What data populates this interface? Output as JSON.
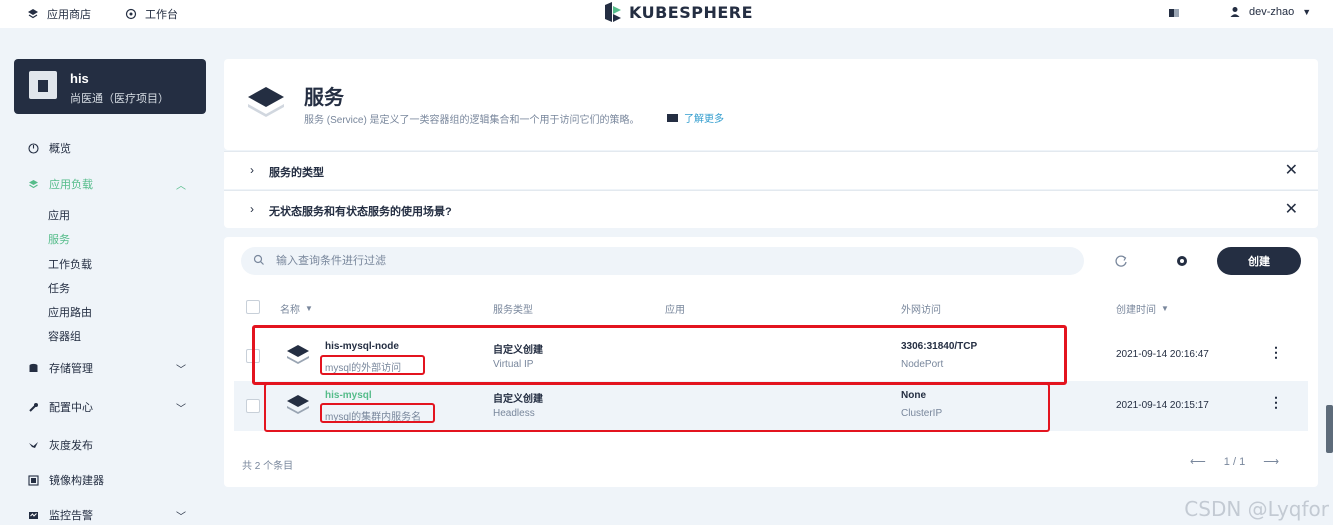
{
  "topbar": {
    "app_store": "应用商店",
    "workbench": "工作台",
    "brand": "KUBESPHERE",
    "user": "dev-zhao"
  },
  "project": {
    "name": "his",
    "description": "尚医通（医疗项目）"
  },
  "nav": {
    "overview": "概览",
    "workloads": "应用负载",
    "workloads_items": [
      "应用",
      "服务",
      "工作负载",
      "任务",
      "应用路由",
      "容器组"
    ],
    "storage": "存储管理",
    "config": "配置中心",
    "grayscale": "灰度发布",
    "image_builder": "镜像构建器",
    "monitoring": "监控告警"
  },
  "header": {
    "title": "服务",
    "description": "服务 (Service) 是定义了一类容器组的逻辑集合和一个用于访问它们的策略。",
    "learn_more": "了解更多"
  },
  "faq": [
    "服务的类型",
    "无状态服务和有状态服务的使用场景?"
  ],
  "toolbar": {
    "search_placeholder": "输入查询条件进行过滤",
    "create_label": "创建"
  },
  "table": {
    "columns": [
      "名称",
      "服务类型",
      "应用",
      "外网访问",
      "创建时间"
    ],
    "rows": [
      {
        "name": "his-mysql-node",
        "description": "mysql的外部访问",
        "type": "自定义创建",
        "type_sub": "Virtual IP",
        "app": "",
        "access": "3306:31840/TCP",
        "access_sub": "NodePort",
        "created": "2021-09-14 20:16:47"
      },
      {
        "name": "his-mysql",
        "description": "mysql的集群内服务名",
        "type": "自定义创建",
        "type_sub": "Headless",
        "app": "",
        "access": "None",
        "access_sub": "ClusterIP",
        "created": "2021-09-14 20:15:17"
      }
    ],
    "total": "共 2 个条目",
    "page": "1 / 1"
  },
  "watermark": "CSDN @Lyqfor",
  "colors": {
    "accent": "#55bc8a",
    "dark": "#242e42",
    "highlight": "#e3141f",
    "link": "#329dce"
  }
}
